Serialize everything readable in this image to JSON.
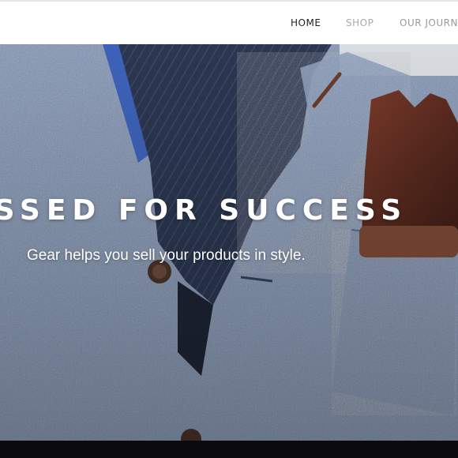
{
  "nav": {
    "items": [
      {
        "label": "HOME",
        "active": true
      },
      {
        "label": "SHOP",
        "active": false
      },
      {
        "label": "OUR JOURNAL",
        "active": false
      }
    ]
  },
  "hero": {
    "title": "ESSED FOR SUCCESS",
    "subtitle": "Gear helps you sell your products in style."
  },
  "colors": {
    "header_bg": "#ffffff",
    "nav_active": "#222222",
    "nav_inactive": "#a9a9a9",
    "jacket_blue": "#7c93b6",
    "scarf_navy": "#2b3650",
    "glove_brown": "#5b2c20",
    "hero_text": "#ffffff"
  }
}
